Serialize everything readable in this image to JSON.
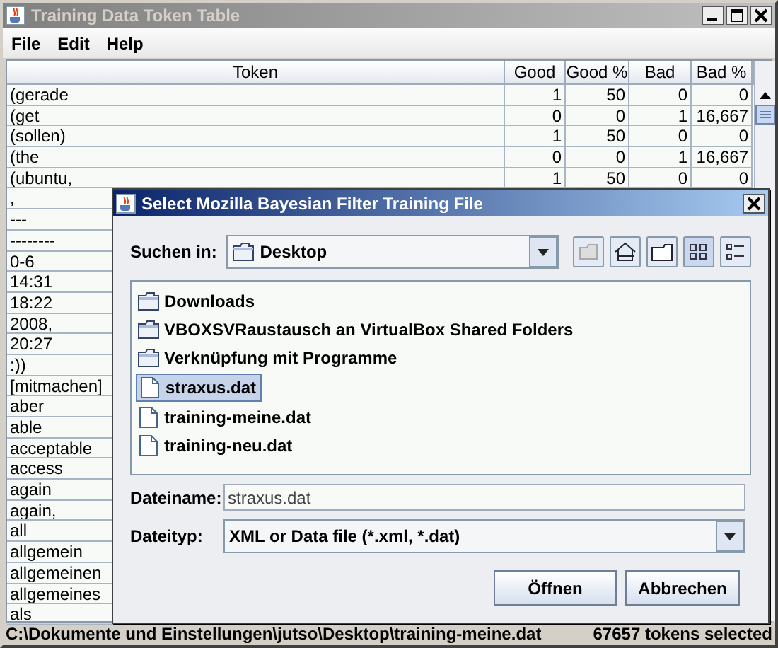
{
  "window": {
    "title": "Training Data Token Table"
  },
  "menu": [
    {
      "label": "File"
    },
    {
      "label": "Edit"
    },
    {
      "label": "Help"
    }
  ],
  "table": {
    "columns": [
      "Token",
      "Good",
      "Good %",
      "Bad",
      "Bad %"
    ],
    "rows": [
      {
        "token": "(gerade",
        "values": [
          "1",
          "50",
          "0",
          "0"
        ]
      },
      {
        "token": "(get",
        "values": [
          "0",
          "0",
          "1",
          "16,667"
        ]
      },
      {
        "token": "(sollen)",
        "values": [
          "1",
          "50",
          "0",
          "0"
        ]
      },
      {
        "token": "(the",
        "values": [
          "0",
          "0",
          "1",
          "16,667"
        ]
      },
      {
        "token": "(ubuntu,",
        "values": [
          "1",
          "50",
          "0",
          "0"
        ]
      },
      {
        "token": ","
      },
      {
        "token": "---"
      },
      {
        "token": "--------"
      },
      {
        "token": "0-6"
      },
      {
        "token": "14:31"
      },
      {
        "token": "18:22"
      },
      {
        "token": "2008,"
      },
      {
        "token": "20:27"
      },
      {
        "token": ":))"
      },
      {
        "token": "[mitmachen]"
      },
      {
        "token": "aber"
      },
      {
        "token": "able"
      },
      {
        "token": "acceptable"
      },
      {
        "token": "access"
      },
      {
        "token": "again"
      },
      {
        "token": "again,"
      },
      {
        "token": "all"
      },
      {
        "token": "allgemein"
      },
      {
        "token": "allgemeinen"
      },
      {
        "token": "allgemeines"
      },
      {
        "token": "als"
      }
    ]
  },
  "status_bar": {
    "path": "C:\\Dokumente und Einstellungen\\jutso\\Desktop\\training-meine.dat",
    "count": "67657 tokens selected"
  },
  "dialog": {
    "title": "Select Mozilla Bayesian Filter Training File",
    "look_in": {
      "label": "Suchen in:",
      "value": "Desktop"
    },
    "files": [
      {
        "name": "Downloads",
        "kind": "folder",
        "selected": false
      },
      {
        "name": "VBOXSVRaustausch an VirtualBox Shared Folders",
        "kind": "folder",
        "selected": false
      },
      {
        "name": "Verknüpfung mit Programme",
        "kind": "folder",
        "selected": false
      },
      {
        "name": "straxus.dat",
        "kind": "file",
        "selected": true
      },
      {
        "name": "training-meine.dat",
        "kind": "file",
        "selected": false
      },
      {
        "name": "training-neu.dat",
        "kind": "file",
        "selected": false
      }
    ],
    "file_name": {
      "label": "Dateiname:",
      "value": "straxus.dat"
    },
    "file_type": {
      "label": "Dateityp:",
      "value": "XML or Data file (*.xml, *.dat)"
    },
    "buttons": [
      "Öffnen",
      "Abbrechen"
    ]
  }
}
